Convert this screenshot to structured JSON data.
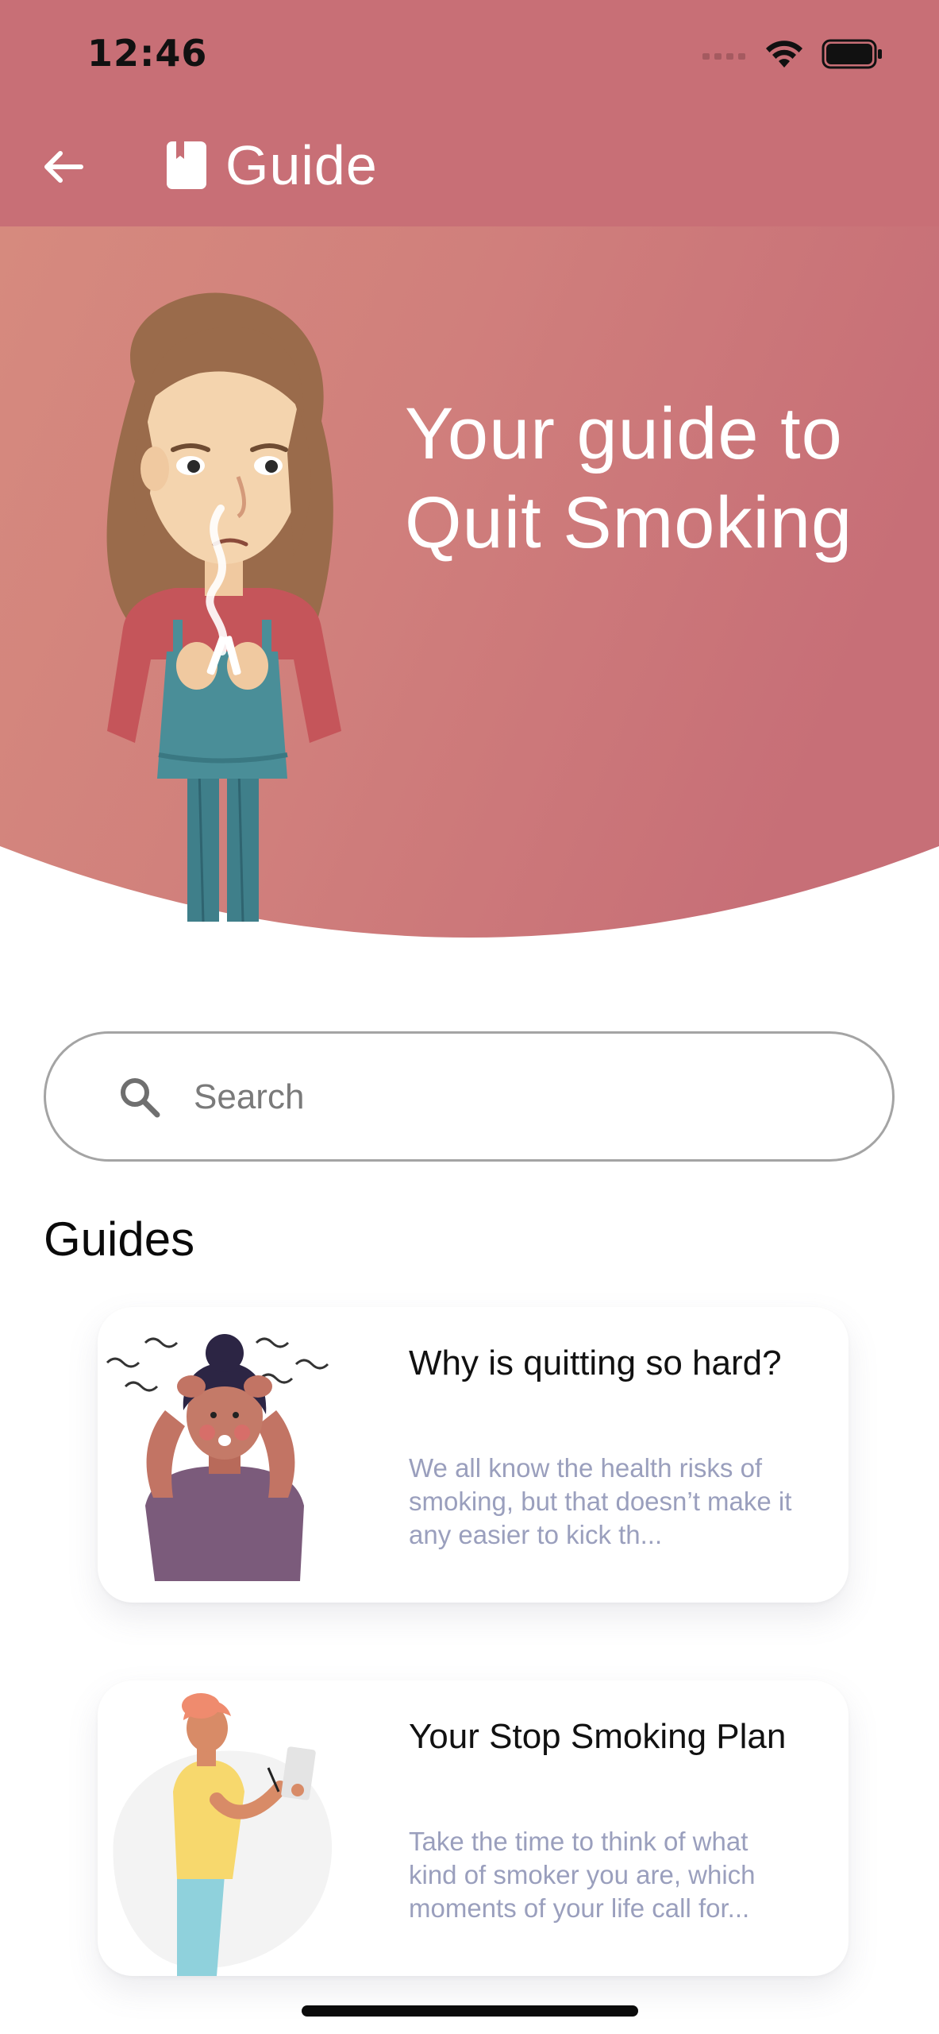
{
  "status_bar": {
    "time": "12:46"
  },
  "nav": {
    "title": "Guide",
    "back_icon": "arrow-left-icon",
    "title_icon": "book-icon"
  },
  "hero": {
    "title": "Your guide to Quit Smoking",
    "background_color": "#c86f76"
  },
  "search": {
    "placeholder": "Search",
    "value": ""
  },
  "guides": {
    "section_title": "Guides",
    "items": [
      {
        "title": "Why is quitting so hard?",
        "description": "We all know the health risks of smoking, but that doesn’t make it any easier to kick th..."
      },
      {
        "title": "Your Stop Smoking Plan",
        "description": "Take the time to think of what kind of smoker you are, which moments of your life call for..."
      }
    ]
  },
  "colors": {
    "accent": "#c86f76",
    "description_text": "#9a9fbd"
  }
}
